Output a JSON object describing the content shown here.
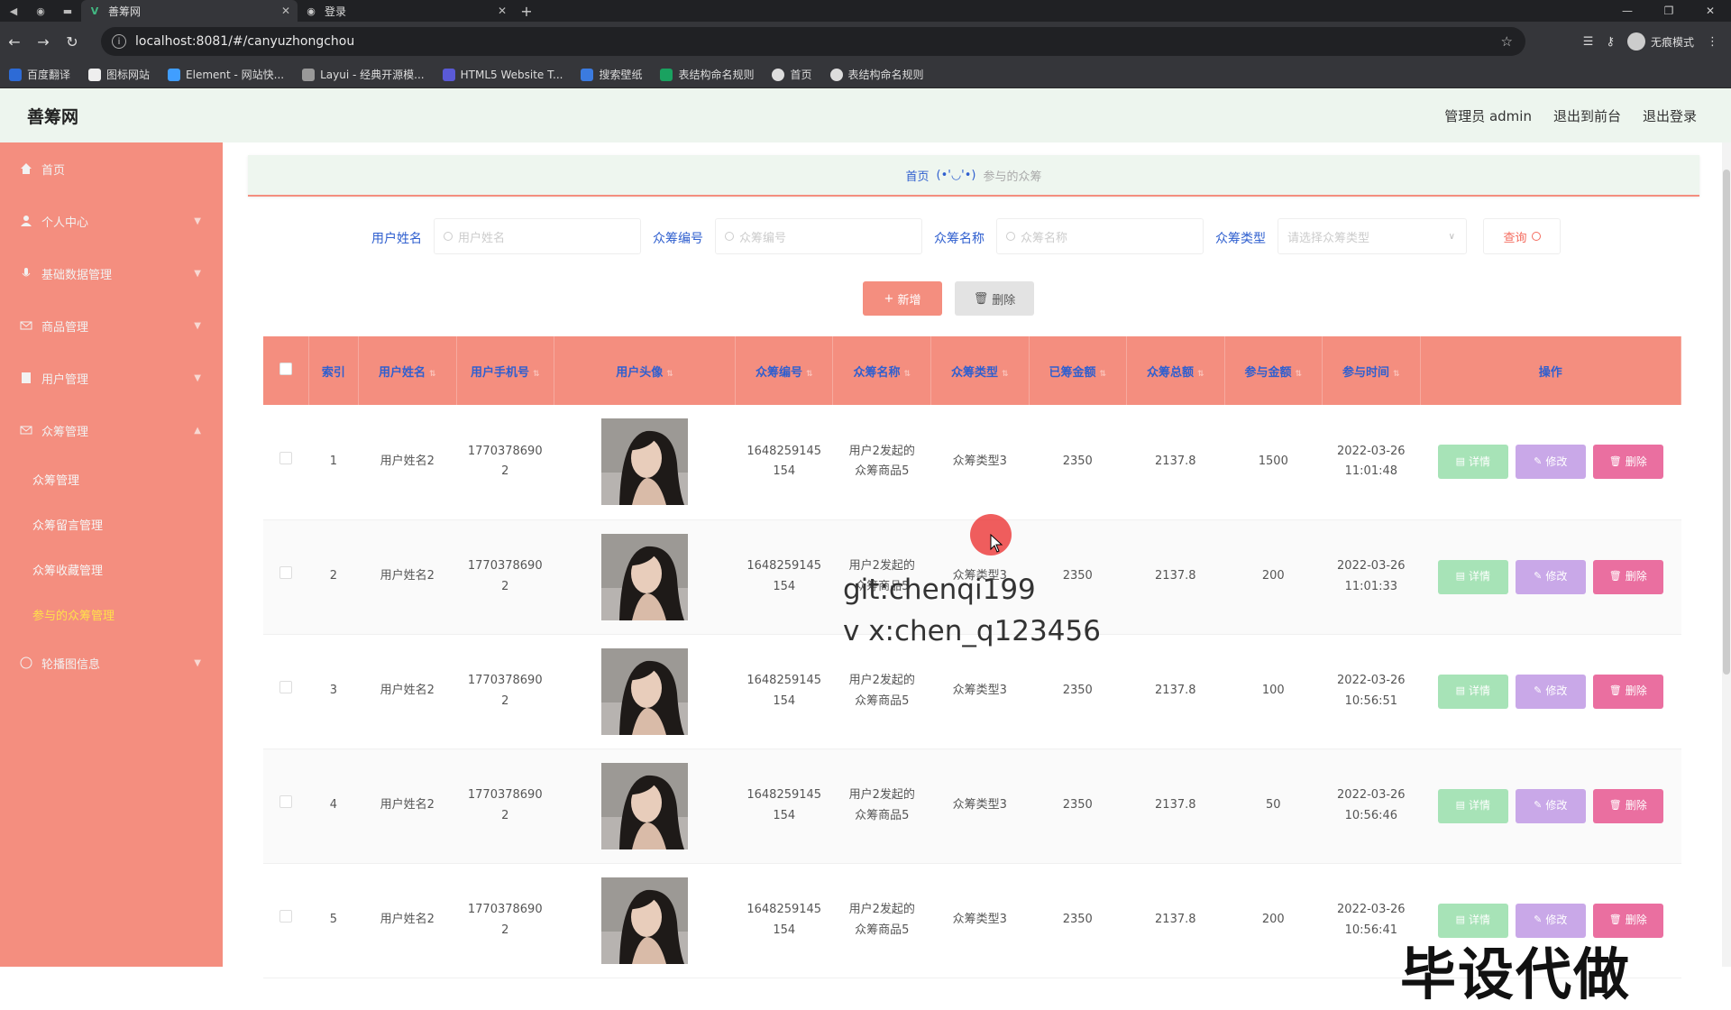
{
  "browser": {
    "tabs": [
      {
        "title": "善筹网",
        "active": true
      },
      {
        "title": "登录",
        "active": false
      }
    ],
    "url": "localhost:8081/#/canyuzhongchou",
    "profile": "无痕模式",
    "bookmarks": [
      "百度翻译",
      "图标网站",
      "Element - 网站快...",
      "Layui - 经典开源模...",
      "HTML5 Website T...",
      "搜索壁纸",
      "表结构命名规则",
      "首页",
      "表结构命名规则"
    ]
  },
  "header": {
    "brand": "善筹网",
    "admin": "管理员 admin",
    "back_front": "退出到前台",
    "logout": "退出登录"
  },
  "sidebar": {
    "items": [
      {
        "label": "首页",
        "icon": "home-icon"
      },
      {
        "label": "个人中心",
        "icon": "user-icon"
      },
      {
        "label": "基础数据管理",
        "icon": "mic-icon"
      },
      {
        "label": "商品管理",
        "icon": "mail-icon"
      },
      {
        "label": "用户管理",
        "icon": "list-icon"
      },
      {
        "label": "众筹管理",
        "icon": "mail-icon"
      }
    ],
    "subitems": [
      {
        "label": "众筹管理",
        "active": false
      },
      {
        "label": "众筹留言管理",
        "active": false
      },
      {
        "label": "众筹收藏管理",
        "active": false
      },
      {
        "label": "参与的众筹管理",
        "active": true
      }
    ],
    "last": {
      "label": "轮播图信息",
      "icon": "image-icon"
    }
  },
  "breadcrumb": {
    "home": "首页",
    "emoticon": "(•'◡'•)",
    "current": "参与的众筹"
  },
  "search": {
    "labels": [
      "用户姓名",
      "众筹编号",
      "众筹名称",
      "众筹类型"
    ],
    "placeholders": [
      "用户姓名",
      "众筹编号",
      "众筹名称"
    ],
    "select_placeholder": "请选择众筹类型",
    "query": "查询"
  },
  "actions": {
    "add": "新增",
    "delete": "删除"
  },
  "table": {
    "headers": [
      "索引",
      "用户姓名",
      "用户手机号",
      "用户头像",
      "众筹编号",
      "众筹名称",
      "众筹类型",
      "已筹金额",
      "众筹总额",
      "参与金额",
      "参与时间",
      "操作"
    ],
    "rows": [
      {
        "idx": "1",
        "name": "用户姓名2",
        "phone1": "1770378690",
        "phone2": "2",
        "no1": "1648259145",
        "no2": "154",
        "title1": "用户2发起的",
        "title2": "众筹商品5",
        "type": "众筹类型3",
        "raised": "2350",
        "total": "2137.8",
        "amount": "1500",
        "date": "2022-03-26",
        "time": "11:01:48"
      },
      {
        "idx": "2",
        "name": "用户姓名2",
        "phone1": "1770378690",
        "phone2": "2",
        "no1": "1648259145",
        "no2": "154",
        "title1": "用户2发起的",
        "title2": "众筹商品5",
        "type": "众筹类型3",
        "raised": "2350",
        "total": "2137.8",
        "amount": "200",
        "date": "2022-03-26",
        "time": "11:01:33"
      },
      {
        "idx": "3",
        "name": "用户姓名2",
        "phone1": "1770378690",
        "phone2": "2",
        "no1": "1648259145",
        "no2": "154",
        "title1": "用户2发起的",
        "title2": "众筹商品5",
        "type": "众筹类型3",
        "raised": "2350",
        "total": "2137.8",
        "amount": "100",
        "date": "2022-03-26",
        "time": "10:56:51"
      },
      {
        "idx": "4",
        "name": "用户姓名2",
        "phone1": "1770378690",
        "phone2": "2",
        "no1": "1648259145",
        "no2": "154",
        "title1": "用户2发起的",
        "title2": "众筹商品5",
        "type": "众筹类型3",
        "raised": "2350",
        "total": "2137.8",
        "amount": "50",
        "date": "2022-03-26",
        "time": "10:56:46"
      },
      {
        "idx": "5",
        "name": "用户姓名2",
        "phone1": "1770378690",
        "phone2": "2",
        "no1": "1648259145",
        "no2": "154",
        "title1": "用户2发起的",
        "title2": "众筹商品5",
        "type": "众筹类型3",
        "raised": "2350",
        "total": "2137.8",
        "amount": "200",
        "date": "2022-03-26",
        "time": "10:56:41"
      }
    ],
    "ops": {
      "detail": "详情",
      "edit": "修改",
      "delete": "删除"
    }
  },
  "watermarks": [
    "git:chenqi199",
    "v x:chen_q123456",
    "毕设代做"
  ],
  "colors": {
    "primary": "#f48e7f",
    "link": "#2f5fcf",
    "detail": "#a7e3b7",
    "edit": "#c9a8e8",
    "delete": "#ea6fa0"
  }
}
